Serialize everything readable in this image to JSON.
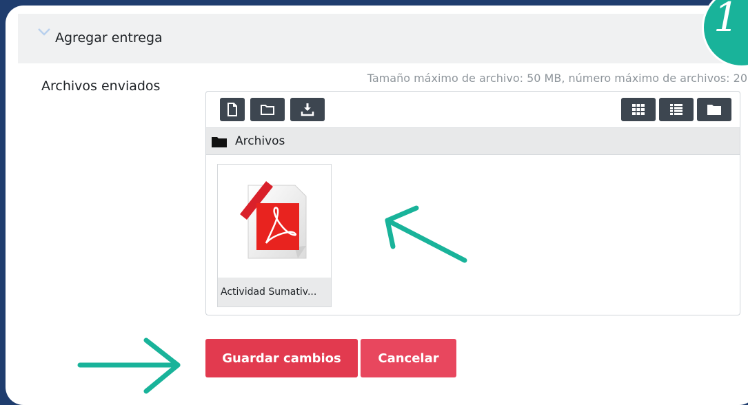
{
  "section": {
    "title": "Agregar entrega"
  },
  "badge": {
    "text": "1"
  },
  "form": {
    "label": "Archivos enviados",
    "limits": "Tamaño máximo de archivo: 50 MB, número máximo de archivos: 20"
  },
  "filemanager": {
    "toolbar_left": [
      {
        "icon": "file-icon"
      },
      {
        "icon": "folder-outline-icon"
      },
      {
        "icon": "download-icon"
      }
    ],
    "toolbar_right": [
      {
        "icon": "grid-view-icon"
      },
      {
        "icon": "list-view-icon"
      },
      {
        "icon": "folder-view-icon"
      }
    ],
    "path_label": "Archivos",
    "files": [
      {
        "name": "Actividad Sumativ...",
        "icon": "pdf-icon"
      }
    ]
  },
  "actions": {
    "save_label": "Guardar cambios",
    "cancel_label": "Cancelar"
  },
  "colors": {
    "background": "#1f3d6e",
    "accent_teal": "#19b39a",
    "save_button": "#e23a4f",
    "cancel_button": "#e8475e",
    "toolbar_button": "#3d4650"
  }
}
